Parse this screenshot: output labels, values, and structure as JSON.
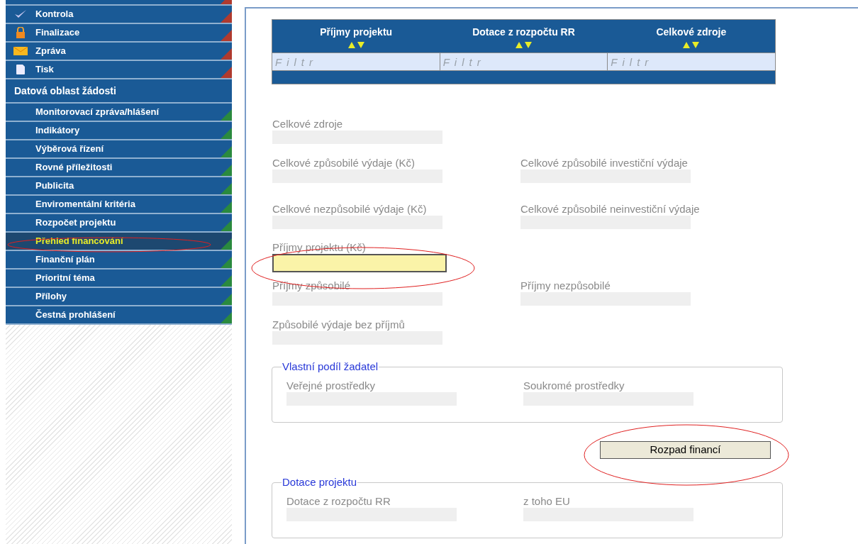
{
  "sidebar": {
    "actions": [
      {
        "label": "Kontrola",
        "kind": "check"
      },
      {
        "label": "Finalizace",
        "kind": "lock"
      },
      {
        "label": "Zpráva",
        "kind": "envelope"
      },
      {
        "label": "Tisk",
        "kind": "page"
      }
    ],
    "section_title": "Datová oblast žádosti",
    "items": [
      {
        "label": "Monitorovací zpráva/hlášení",
        "selected": false
      },
      {
        "label": "Indikátory",
        "selected": false
      },
      {
        "label": "Výběrová řízení",
        "selected": false
      },
      {
        "label": "Rovné příležitosti",
        "selected": false
      },
      {
        "label": "Publicita",
        "selected": false
      },
      {
        "label": "Enviromentální kritéria",
        "selected": false
      },
      {
        "label": "Rozpočet projektu",
        "selected": false
      },
      {
        "label": "Přehled financování",
        "selected": true
      },
      {
        "label": "Finanční plán",
        "selected": false
      },
      {
        "label": "Prioritní téma",
        "selected": false
      },
      {
        "label": "Přílohy",
        "selected": false
      },
      {
        "label": "Čestná prohlášení",
        "selected": false
      }
    ]
  },
  "table": {
    "columns": [
      {
        "label": "Příjmy projektu",
        "filter_placeholder": "Filtr"
      },
      {
        "label": "Dotace z rozpočtu RR",
        "filter_placeholder": "Filtr"
      },
      {
        "label": "Celkové zdroje",
        "filter_placeholder": "Filtr"
      }
    ]
  },
  "form": {
    "rows": [
      [
        {
          "label": "Celkové zdroje",
          "focused": false
        }
      ],
      [
        {
          "label": "Celkové způsobilé výdaje (Kč)",
          "focused": false
        },
        {
          "label": "Celkové způsobilé investiční výdaje",
          "focused": false
        }
      ],
      [
        {
          "label": "Celkové nezpůsobilé výdaje (Kč)",
          "focused": false
        },
        {
          "label": "Celkové způsobilé neinvestiční výdaje",
          "focused": false
        }
      ],
      [
        {
          "label": "Příjmy projektu (Kč)",
          "focused": true
        }
      ],
      [
        {
          "label": "Příjmy způsobilé",
          "focused": false
        },
        {
          "label": "Příjmy nezpůsobilé",
          "focused": false
        }
      ],
      [
        {
          "label": "Způsobilé výdaje bez příjmů",
          "focused": false
        }
      ]
    ]
  },
  "sections": [
    {
      "kind": "group",
      "legend": "Vlastní podíl žadatel",
      "fields": [
        {
          "label": "Veřejné prostředky"
        },
        {
          "label": "Soukromé prostředky"
        }
      ]
    },
    {
      "kind": "button",
      "label": "Rozpad financí"
    },
    {
      "kind": "group",
      "legend": "Dotace projektu",
      "fields": [
        {
          "label": "Dotace z rozpočtu RR"
        },
        {
          "label": "z toho EU"
        }
      ]
    }
  ]
}
